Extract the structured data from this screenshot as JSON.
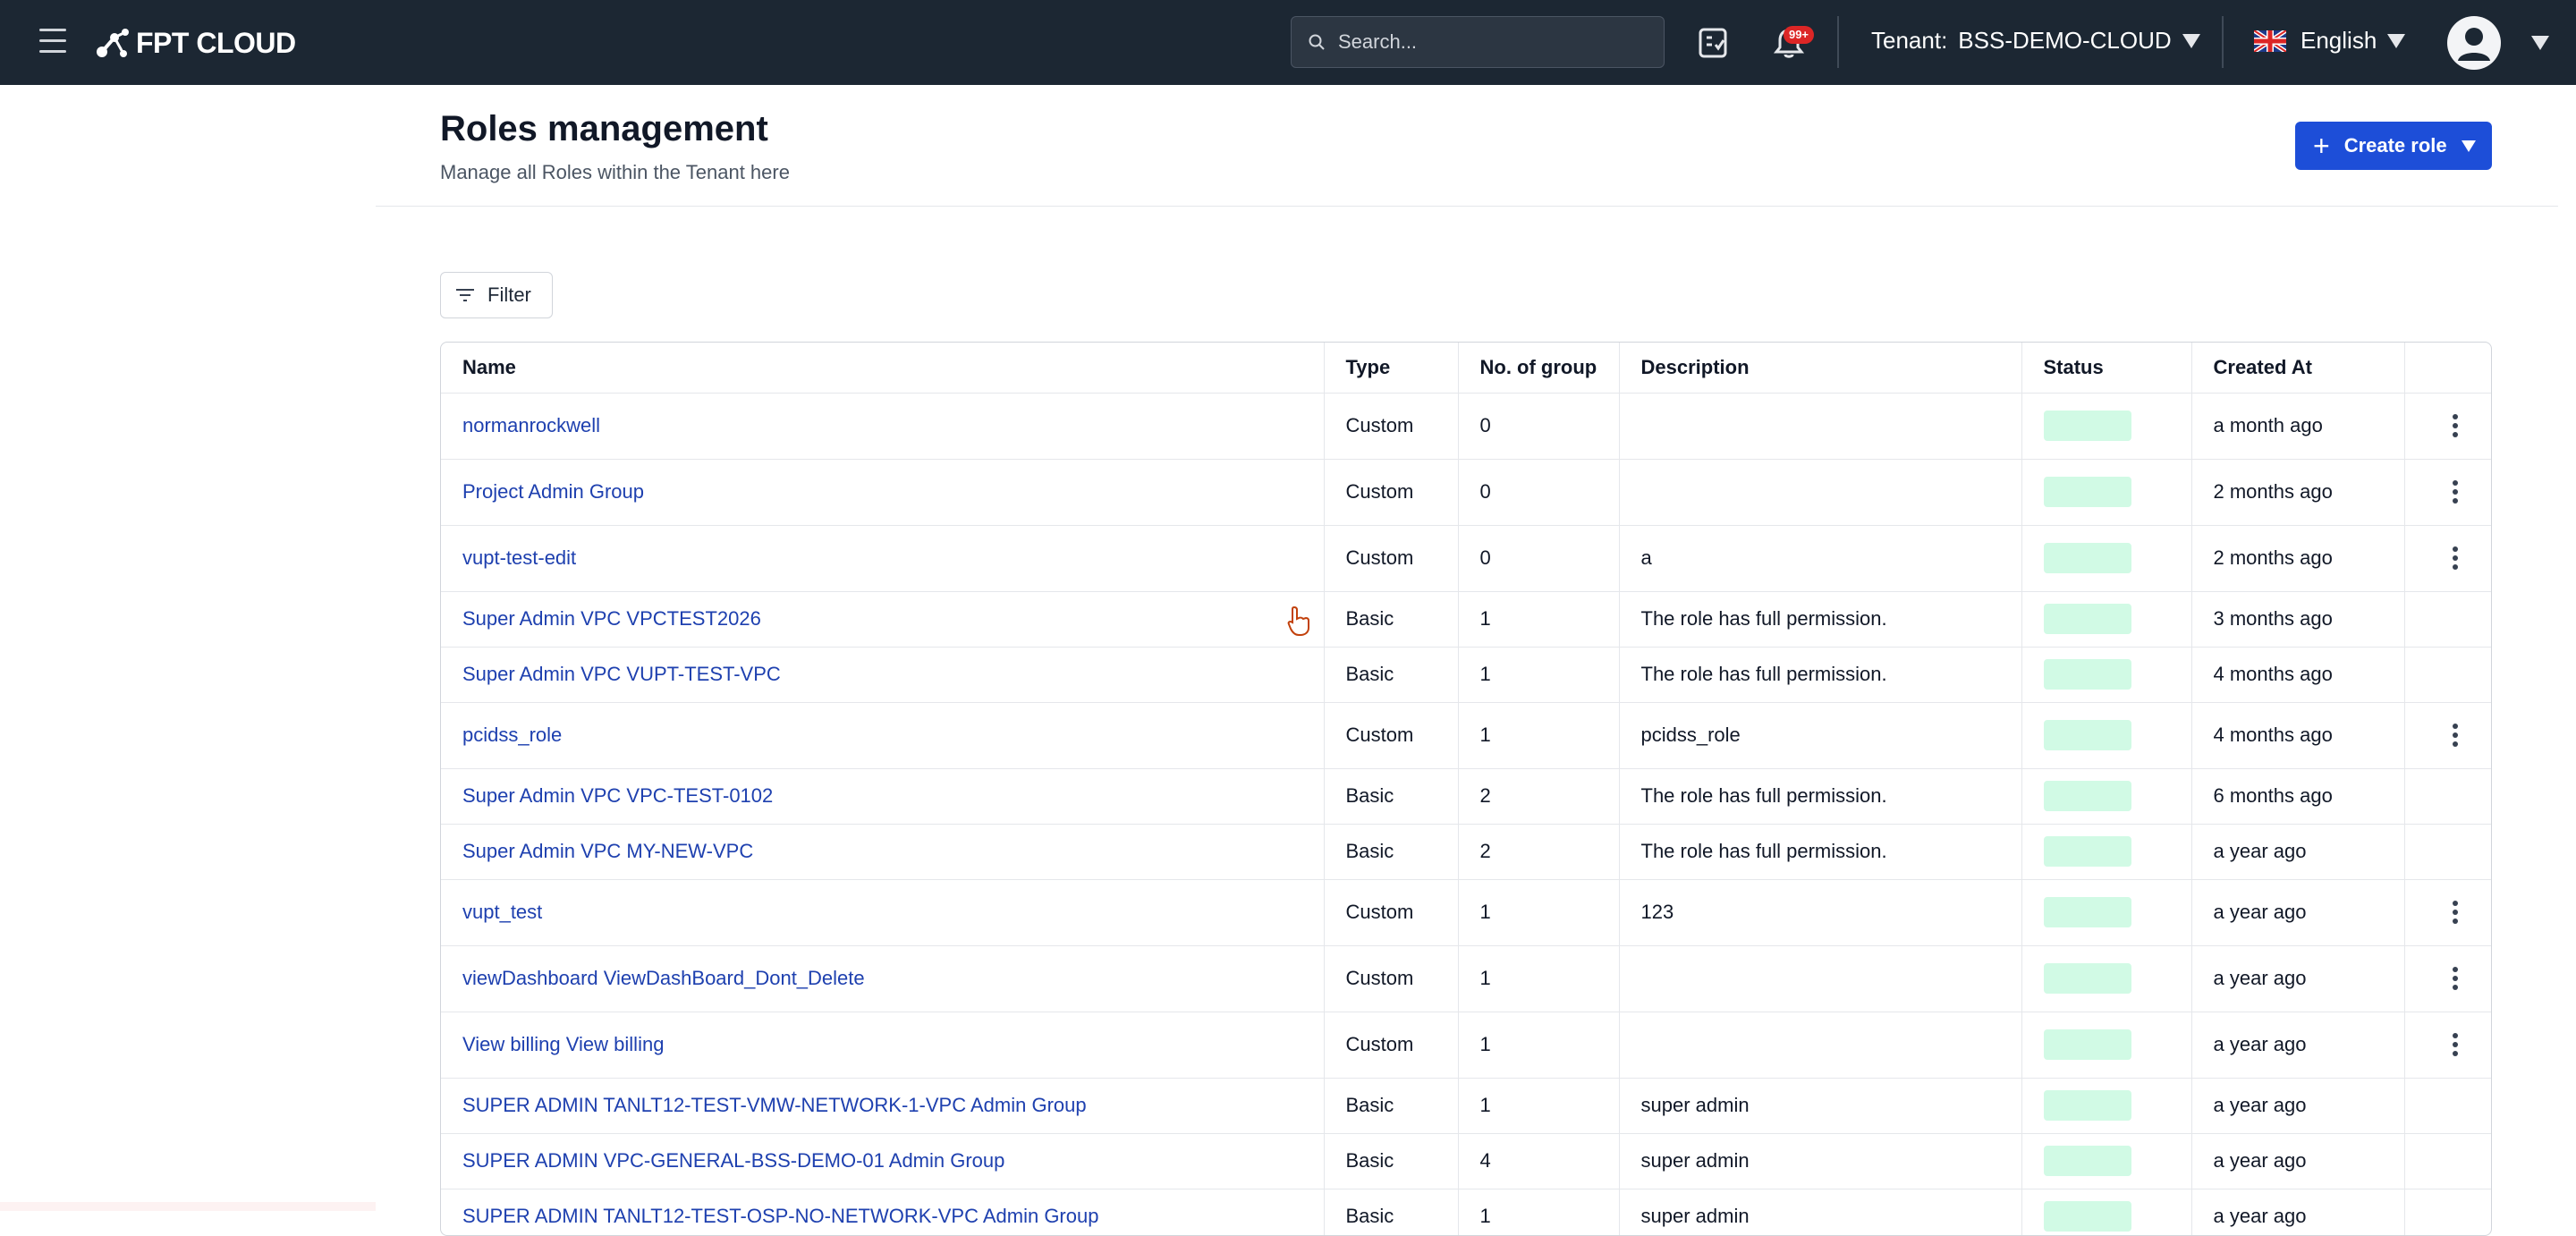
{
  "topbar": {
    "brand": "FPT CLOUD",
    "search_placeholder": "Search...",
    "notification_badge": "99+",
    "tenant_label": "Tenant:",
    "tenant_value": "BSS-DEMO-CLOUD",
    "language": "English",
    "icons": [
      "menu-icon",
      "logo-icon",
      "search-icon",
      "tasks-icon",
      "bell-icon",
      "uk-flag-icon",
      "user-avatar-icon"
    ]
  },
  "page": {
    "title": "Roles management",
    "subtitle": "Manage all Roles within the Tenant here",
    "create_button": "Create role",
    "filter_button": "Filter"
  },
  "colors": {
    "topbar_bg": "#1c2733",
    "primary": "#1d4ed8",
    "link": "#1e40af",
    "status_active": "#d1fae5"
  },
  "table": {
    "columns": [
      "Name",
      "Type",
      "No. of group",
      "Description",
      "Status",
      "Created At",
      ""
    ],
    "rows": [
      {
        "name": "normanrockwell",
        "type": "Custom",
        "groups": "0",
        "description": "",
        "created": "a month ago",
        "actions": true,
        "tall": true
      },
      {
        "name": "Project Admin Group",
        "type": "Custom",
        "groups": "0",
        "description": "",
        "created": "2 months ago",
        "actions": true,
        "tall": true
      },
      {
        "name": "vupt-test-edit",
        "type": "Custom",
        "groups": "0",
        "description": "a",
        "created": "2 months ago",
        "actions": true,
        "tall": true
      },
      {
        "name": "Super Admin VPC VPCTEST2026",
        "type": "Basic",
        "groups": "1",
        "description": "The role has full permission.",
        "created": "3 months ago",
        "actions": false,
        "tall": false
      },
      {
        "name": "Super Admin VPC VUPT-TEST-VPC",
        "type": "Basic",
        "groups": "1",
        "description": "The role has full permission.",
        "created": "4 months ago",
        "actions": false,
        "tall": false
      },
      {
        "name": "pcidss_role",
        "type": "Custom",
        "groups": "1",
        "description": "pcidss_role",
        "created": "4 months ago",
        "actions": true,
        "tall": true
      },
      {
        "name": "Super Admin VPC VPC-TEST-0102",
        "type": "Basic",
        "groups": "2",
        "description": "The role has full permission.",
        "created": "6 months ago",
        "actions": false,
        "tall": false
      },
      {
        "name": "Super Admin VPC MY-NEW-VPC",
        "type": "Basic",
        "groups": "2",
        "description": "The role has full permission.",
        "created": "a year ago",
        "actions": false,
        "tall": false
      },
      {
        "name": "vupt_test",
        "type": "Custom",
        "groups": "1",
        "description": "123",
        "created": "a year ago",
        "actions": true,
        "tall": true
      },
      {
        "name": "viewDashboard ViewDashBoard_Dont_Delete",
        "type": "Custom",
        "groups": "1",
        "description": "",
        "created": "a year ago",
        "actions": true,
        "tall": true
      },
      {
        "name": "View billing View billing",
        "type": "Custom",
        "groups": "1",
        "description": "",
        "created": "a year ago",
        "actions": true,
        "tall": true
      },
      {
        "name": "SUPER ADMIN TANLT12-TEST-VMW-NETWORK-1-VPC Admin Group",
        "type": "Basic",
        "groups": "1",
        "description": "super admin",
        "created": "a year ago",
        "actions": false,
        "tall": false
      },
      {
        "name": "SUPER ADMIN VPC-GENERAL-BSS-DEMO-01 Admin Group",
        "type": "Basic",
        "groups": "4",
        "description": "super admin",
        "created": "a year ago",
        "actions": false,
        "tall": false
      },
      {
        "name": "SUPER ADMIN TANLT12-TEST-OSP-NO-NETWORK-VPC Admin Group",
        "type": "Basic",
        "groups": "1",
        "description": "super admin",
        "created": "a year ago",
        "actions": false,
        "tall": false
      }
    ]
  }
}
